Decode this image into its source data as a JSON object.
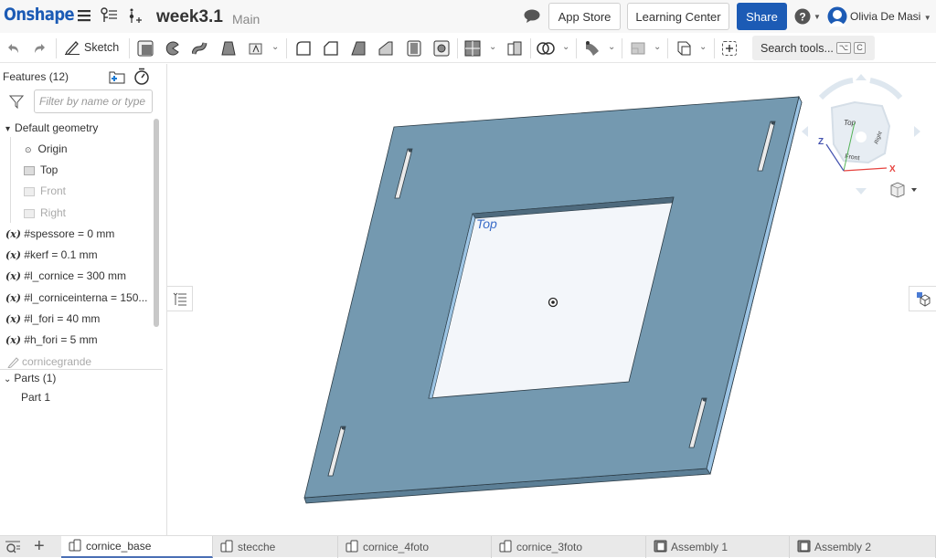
{
  "app": {
    "logo": "Onshape",
    "document_title": "week3.1",
    "branch": "Main"
  },
  "header": {
    "app_store": "App Store",
    "learning_center": "Learning Center",
    "share": "Share",
    "user_name": "Olivia De Masi"
  },
  "toolbar": {
    "sketch_label": "Sketch",
    "search_placeholder": "Search tools...",
    "search_shortcut_1": "⌥",
    "search_shortcut_2": "C"
  },
  "features": {
    "title": "Features (12)",
    "filter_placeholder": "Filter by name or type",
    "default_geometry": "Default geometry",
    "origin": "Origin",
    "planes": [
      "Top",
      "Front",
      "Right"
    ],
    "variables": [
      "#spessore = 0 mm",
      "#kerf = 0.1 mm",
      "#l_cornice = 300 mm",
      "#l_corniceinterna = 150...",
      "#l_fori = 40 mm",
      "#h_fori = 5 mm"
    ],
    "variable_symbol": "(x)",
    "sketch": "cornicegrande",
    "parts_header": "Parts (1)",
    "parts": [
      "Part 1"
    ]
  },
  "viewport": {
    "plane_label": "Top",
    "part_color": "#7499b0",
    "viewcube": {
      "top": "Top",
      "front": "Front",
      "right": "Right",
      "axis_x": "X",
      "axis_z": "Z"
    }
  },
  "tabs": [
    {
      "label": "cornice_base",
      "type": "partstudio",
      "active": true
    },
    {
      "label": "stecche",
      "type": "partstudio",
      "active": false
    },
    {
      "label": "cornice_4foto",
      "type": "partstudio",
      "active": false
    },
    {
      "label": "cornice_3foto",
      "type": "partstudio",
      "active": false
    },
    {
      "label": "Assembly 1",
      "type": "assembly",
      "active": false
    },
    {
      "label": "Assembly 2",
      "type": "assembly",
      "active": false
    }
  ]
}
